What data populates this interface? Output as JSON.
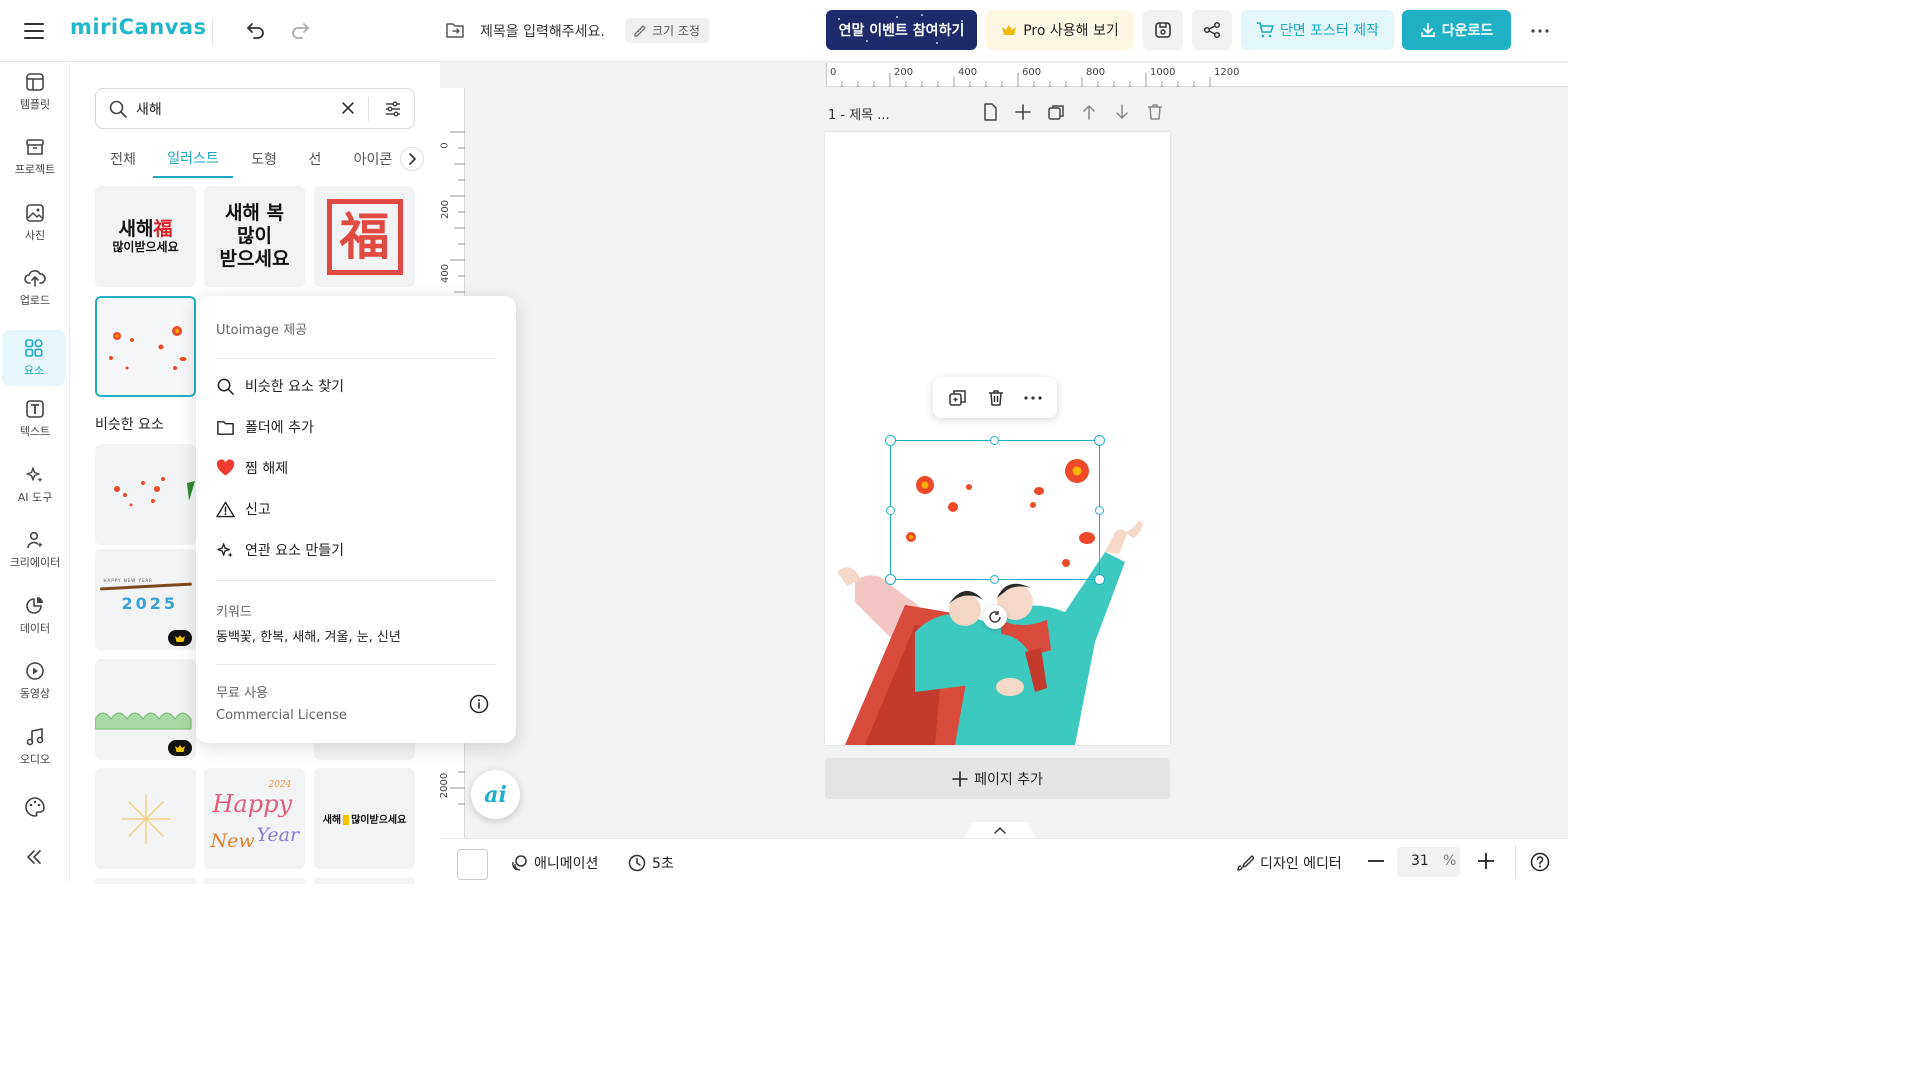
{
  "app": {
    "logo_text": "miriCanvas",
    "title_placeholder": "제목을 입력해주세요.",
    "resize_label": "크기 조정",
    "event_button": "연말 이벤트 참여하기",
    "pro_button": "Pro 사용해 보기",
    "poster_button": "단면 포스터 제작",
    "download_button": "다운로드"
  },
  "rail": {
    "items": [
      {
        "label": "템플릿",
        "icon": "template-icon"
      },
      {
        "label": "프로젝트",
        "icon": "project-icon"
      },
      {
        "label": "사진",
        "icon": "photo-icon"
      },
      {
        "label": "업로드",
        "icon": "upload-icon"
      },
      {
        "label": "요소",
        "icon": "elements-icon",
        "active": true
      },
      {
        "label": "텍스트",
        "icon": "text-icon"
      },
      {
        "label": "AI 도구",
        "icon": "ai-tools-icon"
      },
      {
        "label": "크리에이터",
        "icon": "creator-icon"
      },
      {
        "label": "데이터",
        "icon": "data-icon"
      },
      {
        "label": "동영상",
        "icon": "video-icon"
      },
      {
        "label": "오디오",
        "icon": "audio-icon"
      }
    ]
  },
  "panel": {
    "search_value": "새해",
    "tabs": [
      {
        "label": "전체"
      },
      {
        "label": "일러스트",
        "active": true
      },
      {
        "label": "도형"
      },
      {
        "label": "선"
      },
      {
        "label": "아이콘"
      }
    ],
    "similar_heading": "비슷한 요소",
    "thumbs": {
      "t1_line1": "새해",
      "t1_char": "福",
      "t1_line2": "많이받으세요",
      "t2_line1": "새해 복",
      "t2_line2": "많이",
      "t2_line3": "받으세요",
      "t3_char": "福",
      "t5_small": "HAPPY NEW YEAR",
      "t5_year": "2025",
      "t9_year": "2024",
      "t9_line1": "Happy",
      "t9_line2": "New",
      "t9_line3": "Year",
      "t10_text": "새해",
      "t10_text2": "많이받으세요"
    }
  },
  "context_menu": {
    "provider": "Utoimage 제공",
    "items": [
      {
        "label": "비슷한 요소 찾기",
        "icon": "search-icon"
      },
      {
        "label": "폴더에 추가",
        "icon": "folder-icon"
      },
      {
        "label": "찜 해제",
        "icon": "heart-icon"
      },
      {
        "label": "신고",
        "icon": "warning-icon"
      },
      {
        "label": "연관 요소 만들기",
        "icon": "sparkle-icon"
      }
    ],
    "keywords_title": "키워드",
    "keywords": "동백꽃, 한복, 새해, 겨울, 눈, 신년",
    "license_title": "무료 사용",
    "license_type": "Commercial License"
  },
  "canvas": {
    "page_label": "1 - 제목 ...",
    "add_page": "페이지 추가",
    "ruler_h": [
      "0",
      "200",
      "400",
      "600",
      "800",
      "1000",
      "1200"
    ],
    "ruler_v": [
      "0",
      "200",
      "400",
      "2000"
    ]
  },
  "bottom": {
    "animation": "애니메이션",
    "duration": "5초",
    "design_editor": "디자인 에디터",
    "zoom": "31",
    "zoom_unit": "%"
  },
  "colors": {
    "accent": "#1fb0c6",
    "event_bg": "#1d2a6b",
    "pro_bg": "#fdf7e3",
    "flower_red": "#e8392b",
    "hanbok_teal": "#3ec9c0"
  }
}
